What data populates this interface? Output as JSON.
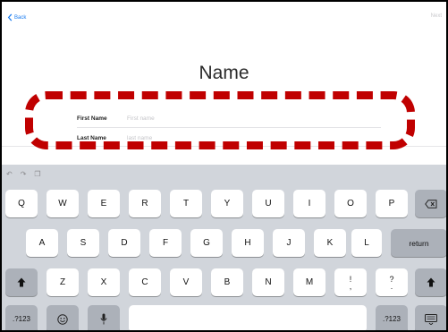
{
  "nav": {
    "back_label": "Back",
    "next_label": "Next"
  },
  "page": {
    "title": "Name"
  },
  "form": {
    "first_name": {
      "label": "First Name",
      "placeholder": "First name",
      "value": ""
    },
    "last_name": {
      "label": "Last Name",
      "placeholder": "last name",
      "value": ""
    }
  },
  "keyboard": {
    "row1": [
      "Q",
      "W",
      "E",
      "R",
      "T",
      "Y",
      "U",
      "I",
      "O",
      "P"
    ],
    "row2": [
      "A",
      "S",
      "D",
      "F",
      "G",
      "H",
      "J",
      "K",
      "L"
    ],
    "row3": [
      "Z",
      "X",
      "C",
      "V",
      "B",
      "N",
      "M"
    ],
    "punct_top_1": "!",
    "punct_bottom_1": ",",
    "punct_top_2": "?",
    "punct_bottom_2": ".",
    "return_label": "return",
    "numbers_left_label": ".?123",
    "numbers_right_label": ".?123"
  },
  "icons": {
    "back": "chevron-left-icon",
    "undo": "undo-icon",
    "redo": "redo-icon",
    "paste": "clipboard-icon",
    "delete": "backspace-icon",
    "shift": "shift-icon",
    "emoji": "emoji-icon",
    "dictation": "microphone-icon",
    "hide_keyboard": "keyboard-icon"
  },
  "colors": {
    "accent": "#1a7cf0",
    "highlight": "#c00000",
    "keyboard_bg": "#d1d5db"
  }
}
